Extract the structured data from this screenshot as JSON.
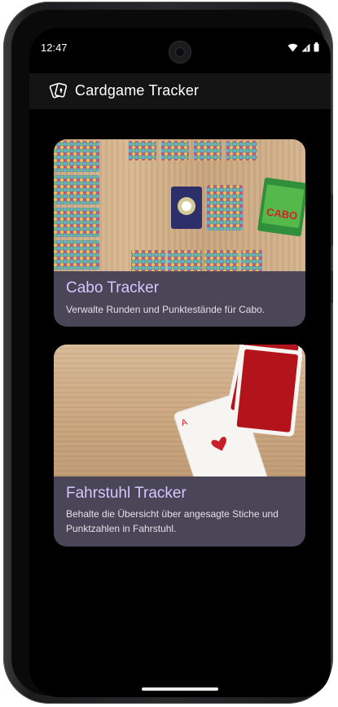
{
  "status_bar": {
    "time": "12:47"
  },
  "app_bar": {
    "title": "Cardgame Tracker",
    "logo_icon": "playing-cards-icon"
  },
  "cards": [
    {
      "title": "Cabo Tracker",
      "description": "Verwalte Runden und Punktestände für Cabo.",
      "box_text": "CABO"
    },
    {
      "title": "Fahrstuhl Tracker",
      "description": "Behalte die Übersicht über angesagte Stiche und Punktzahlen in Fahrstuhl."
    }
  ],
  "colors": {
    "card_bg": "#4a4557",
    "card_title": "#d6c6ff",
    "screen_bg": "#000000",
    "appbar_bg": "#141414"
  }
}
